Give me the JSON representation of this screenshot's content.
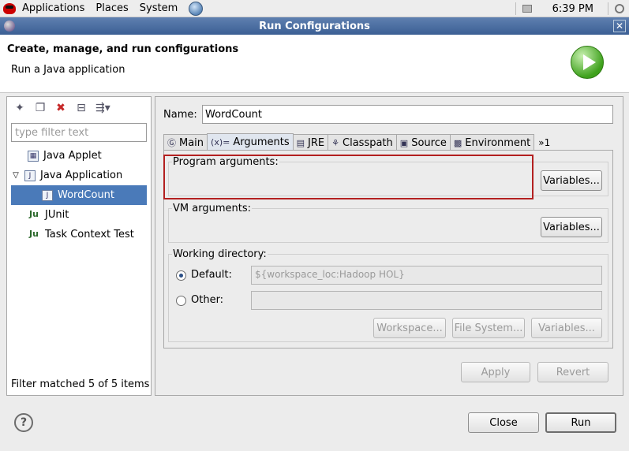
{
  "panel": {
    "menus": [
      "Applications",
      "Places",
      "System"
    ],
    "clock": "6:39 PM"
  },
  "window": {
    "title": "Run Configurations"
  },
  "banner": {
    "title": "Create, manage, and run configurations",
    "subtitle": "Run a Java application"
  },
  "sidebar": {
    "filter_placeholder": "type filter text",
    "tree": [
      {
        "label": "Java Applet",
        "icon": "java-applet-icon",
        "level": 1
      },
      {
        "label": "Java Application",
        "icon": "java-application-icon",
        "level": 0,
        "expanded": true
      },
      {
        "label": "WordCount",
        "icon": "java-config-icon",
        "level": 2,
        "selected": true
      },
      {
        "label": "JUnit",
        "icon": "junit-icon",
        "level": 1
      },
      {
        "label": "Task Context Test",
        "icon": "junit-icon",
        "level": 1
      }
    ],
    "status": "Filter matched 5 of 5 items"
  },
  "config": {
    "name_label": "Name:",
    "name_value": "WordCount",
    "tabs": [
      {
        "label": "Main",
        "icon": "main-tab-icon"
      },
      {
        "label": "Arguments",
        "icon": "arguments-tab-icon",
        "active": true
      },
      {
        "label": "JRE",
        "icon": "jre-tab-icon"
      },
      {
        "label": "Classpath",
        "icon": "classpath-tab-icon"
      },
      {
        "label": "Source",
        "icon": "source-tab-icon"
      },
      {
        "label": "Environment",
        "icon": "environment-tab-icon"
      }
    ],
    "tabs_overflow": "»1",
    "program_args_label": "Program arguments:",
    "vm_args_label": "VM arguments:",
    "variables_label": "Variables...",
    "working_dir_label": "Working directory:",
    "default_label": "Default:",
    "default_value": "${workspace_loc:Hadoop HOL}",
    "other_label": "Other:",
    "workspace_label": "Workspace...",
    "filesystem_label": "File System...",
    "apply_label": "Apply",
    "revert_label": "Revert"
  },
  "footer": {
    "close_label": "Close",
    "run_label": "Run"
  },
  "colors": {
    "titlebar": "#3b5f94",
    "selection": "#4a7ab9",
    "highlight_box": "#b32020"
  }
}
